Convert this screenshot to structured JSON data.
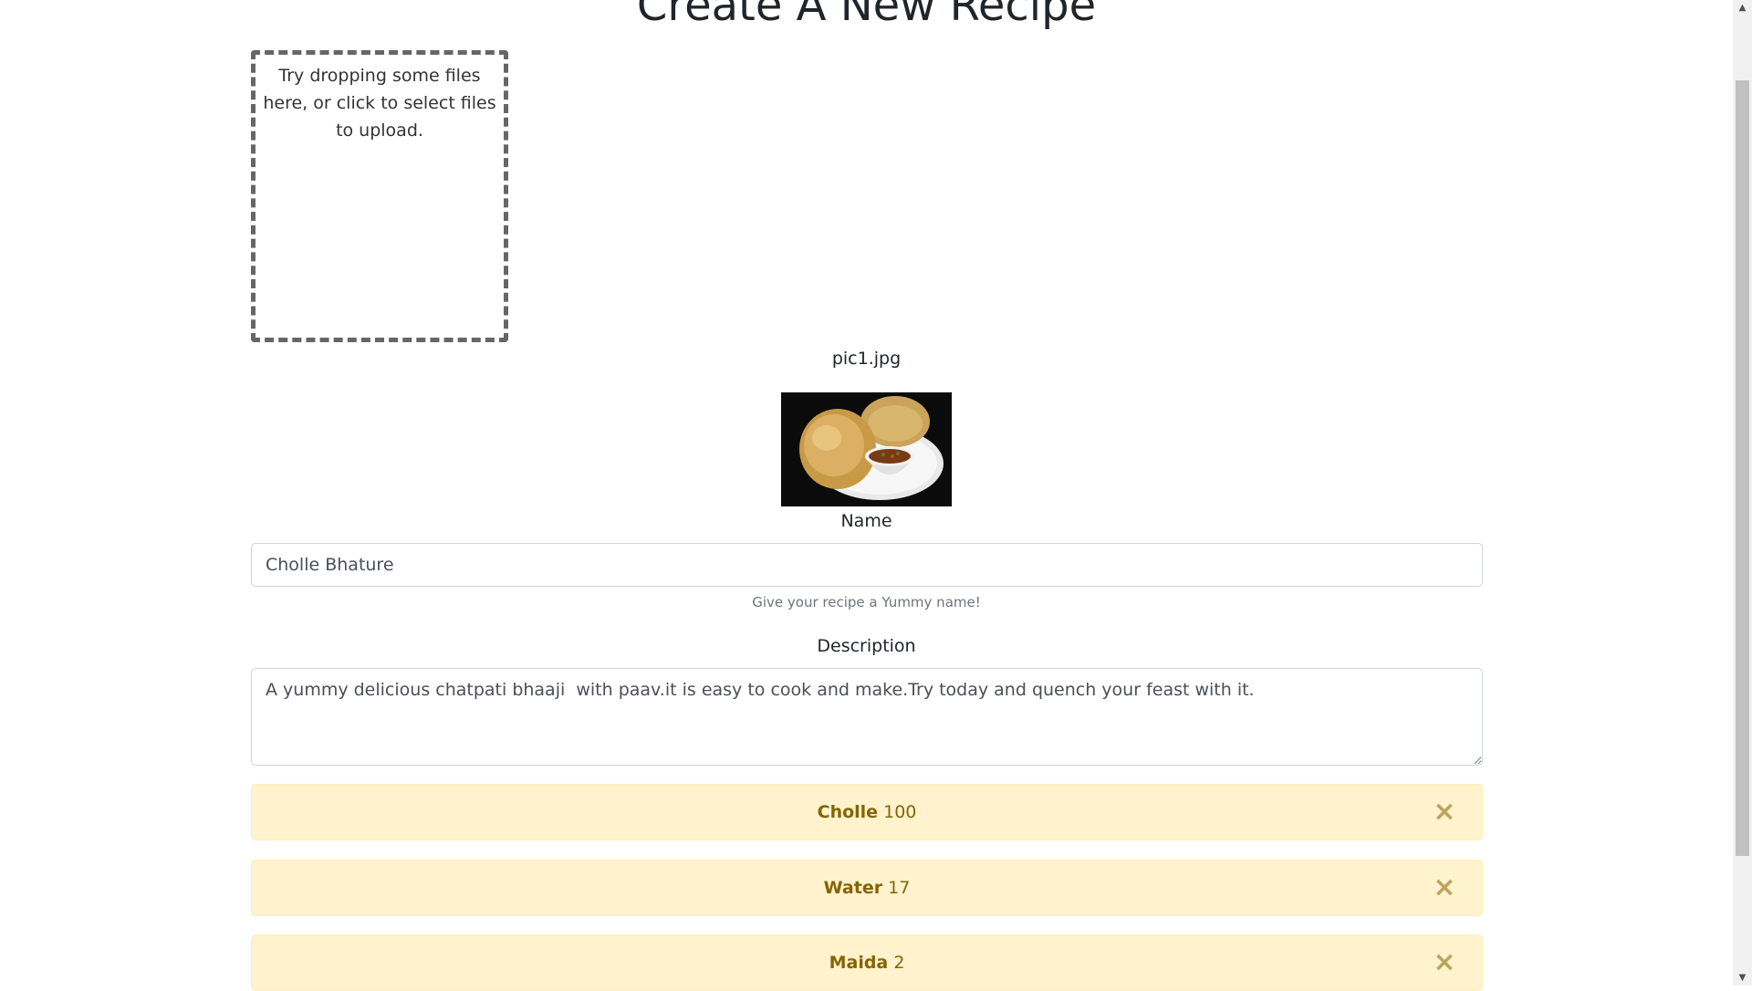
{
  "page": {
    "title": "Create A New Recipe"
  },
  "dropzone": {
    "text": "Try dropping some files here, or click to select files to upload."
  },
  "upload": {
    "file_name": "pic1.jpg",
    "image_icon": "food-photo"
  },
  "name_field": {
    "label": "Name",
    "value": "Cholle Bhature",
    "help": "Give your recipe a Yummy name!"
  },
  "description_field": {
    "label": "Description",
    "value": "A yummy delicious chatpati bhaaji  with paav.it is easy to cook and make.Try today and quench your feast with it."
  },
  "ingredients": [
    {
      "name": "Cholle",
      "quantity": "100",
      "close": "×"
    },
    {
      "name": "Water",
      "quantity": "17",
      "close": "×"
    },
    {
      "name": "Maida",
      "quantity": "2",
      "close": "×"
    }
  ],
  "scrollbar": {
    "up_arrow": "▲",
    "down_arrow": "▼"
  },
  "colors": {
    "alert_bg": "#fff3cd",
    "alert_text": "#856404",
    "title": "#212529"
  }
}
